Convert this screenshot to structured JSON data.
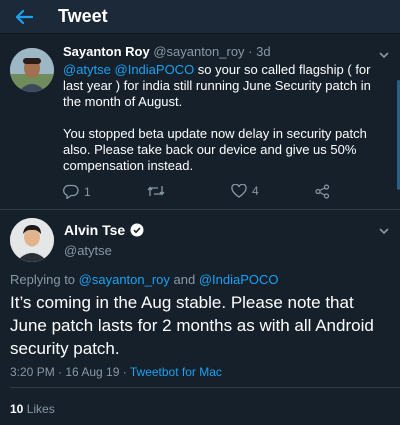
{
  "topbar": {
    "title": "Tweet",
    "back_icon": "arrow-left-icon"
  },
  "reply_tweet": {
    "name": "Sayanton Roy",
    "handle": "@sayanton_roy",
    "separator": " · ",
    "time": "3d",
    "mention1": "@atytse",
    "mention2": "@IndiaPOCO",
    "text1_rest": " so your so called flagship ( for last year ) for india still running June Security patch in the month of August.",
    "text2": "You stopped beta update now delay in security patch also. Please take back our device and give us 50% compensation instead.",
    "replies_count": "1",
    "retweets_count": "",
    "likes_count": "4"
  },
  "main_tweet": {
    "name": "Alvin Tse",
    "handle": "@atytse",
    "replying_to_label": "Replying to ",
    "reply_mention1": "@sayanton_roy",
    "reply_and": " and ",
    "reply_mention2": "@IndiaPOCO",
    "text": "It’s coming in the Aug stable. Please note that June patch lasts for 2 months as with all Android security patch.",
    "timestamp": "3:20 PM · 16 Aug 19 · ",
    "client": "Tweetbot for Mac",
    "likes_count": "10",
    "likes_label": " Likes"
  },
  "colors": {
    "background": "#15202b",
    "topbar": "#1c2938",
    "accent": "#1da1f2",
    "muted": "#8899a6"
  }
}
